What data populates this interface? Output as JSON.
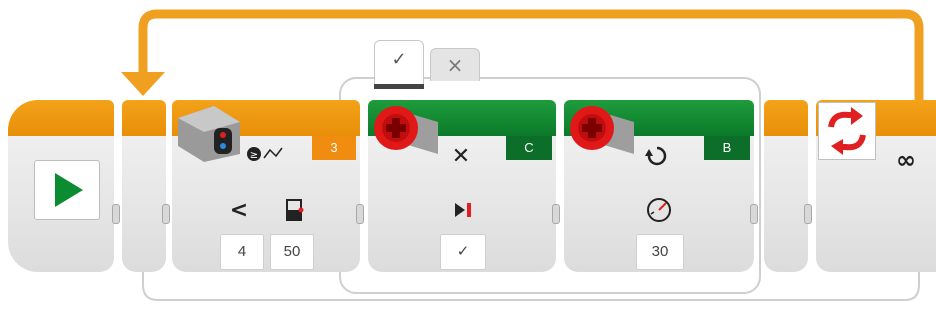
{
  "start_block": {
    "play_icon": "play-icon"
  },
  "sensor_block": {
    "icon": "sensor-icon",
    "mode_icon": "compare-mode-icon",
    "port": "3",
    "comparison_symbol": "<",
    "params": [
      "4",
      "50"
    ]
  },
  "switch": {
    "tabs": [
      {
        "label": "✓"
      },
      {
        "label": "×"
      }
    ]
  },
  "motor_c": {
    "port": "C",
    "action_symbol": "✕",
    "brake_icon": "brake-icon",
    "brake_value": "✓"
  },
  "motor_b": {
    "port": "B",
    "mode_icon": "rotate-icon",
    "speed_icon": "speedometer-icon",
    "power": "30"
  },
  "loop_end": {
    "icon": "loop-icon",
    "mode_symbol": "∞"
  },
  "colors": {
    "orange": "#f09810",
    "green": "#12883a",
    "motor_red": "#e01818"
  }
}
